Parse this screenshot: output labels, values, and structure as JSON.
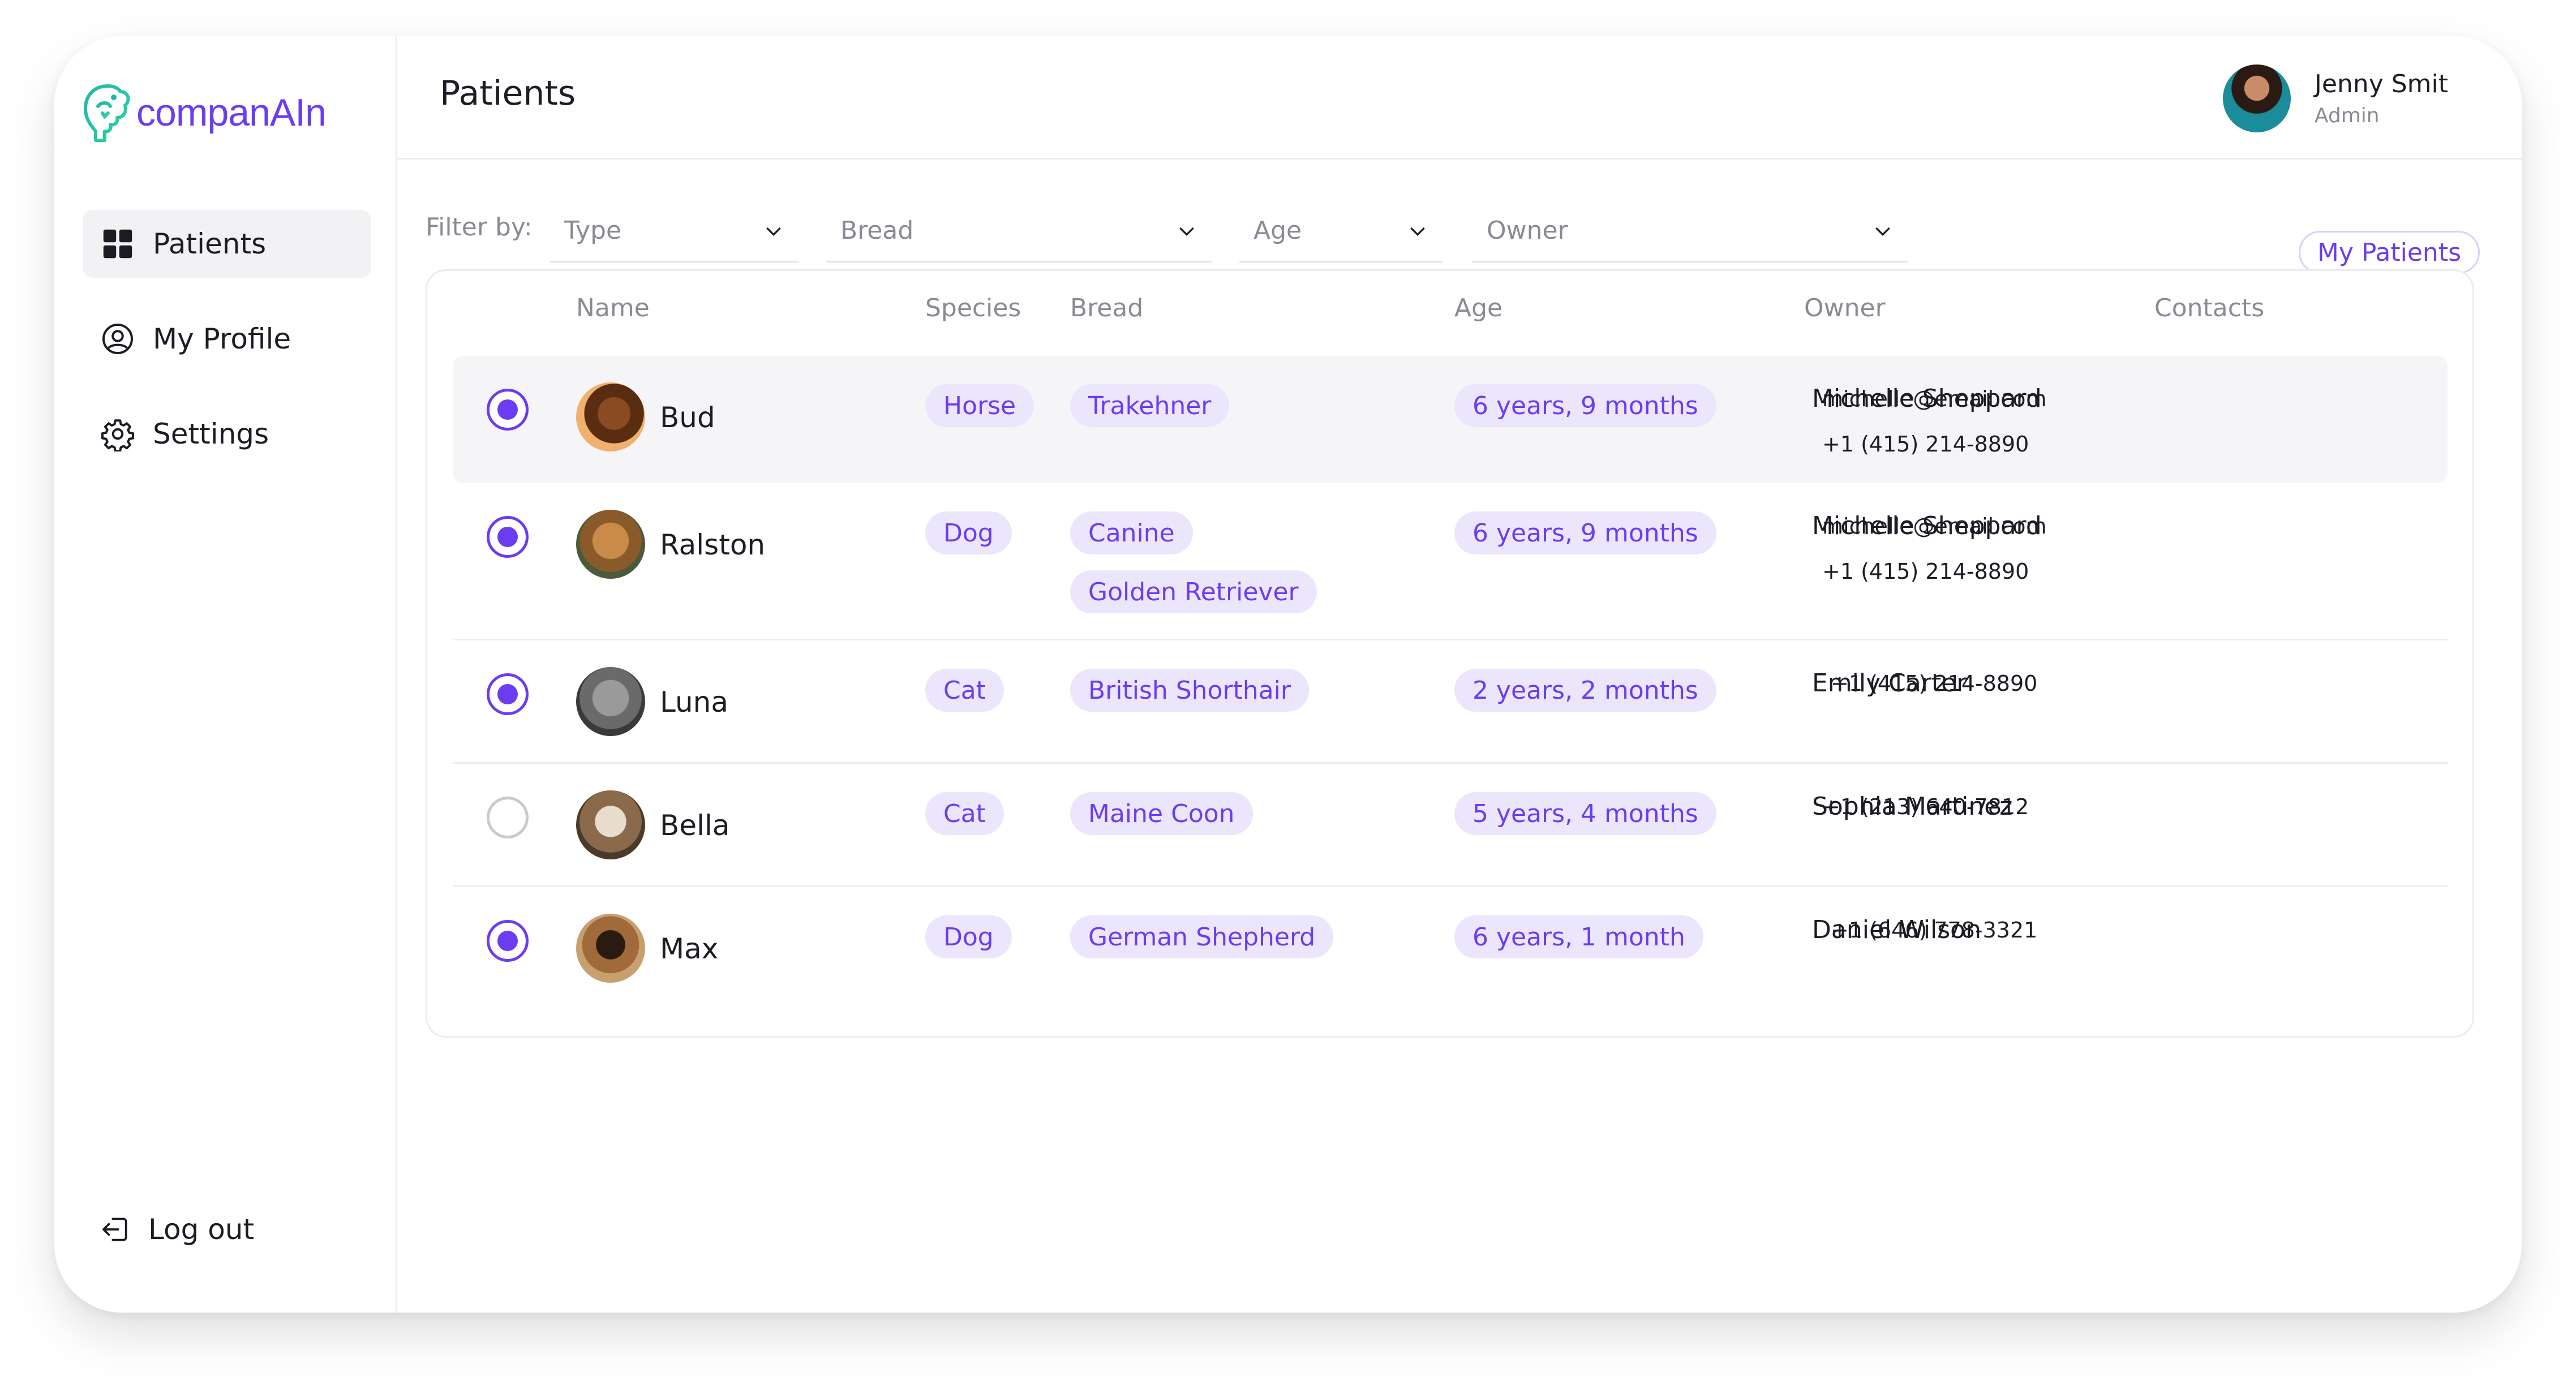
{
  "app": {
    "logo_text": "companAIn",
    "brand_color": "#6b3cf0",
    "logo_color": "#1fb8a6"
  },
  "sidebar": {
    "items": [
      {
        "label": "Patients",
        "icon": "grid-icon",
        "active": true
      },
      {
        "label": "My Profile",
        "icon": "user-circle-icon",
        "active": false
      },
      {
        "label": "Settings",
        "icon": "gear-icon",
        "active": false
      }
    ],
    "logout_label": "Log out"
  },
  "header": {
    "title": "Patients",
    "user_name": "Jenny Smit",
    "user_role": "Admin"
  },
  "filters": {
    "label": "Filter by:",
    "type": "Type",
    "bread": "Bread",
    "age": "Age",
    "owner": "Owner",
    "my_patients": "My Patients"
  },
  "table": {
    "columns": {
      "name": "Name",
      "species": "Species",
      "bread": "Bread",
      "age": "Age",
      "owner": "Owner",
      "contacts": "Contacts"
    },
    "rows": [
      {
        "name": "Bud",
        "species": "Horse",
        "breeds": [
          "Trakehner"
        ],
        "age": "6 years, 9 months",
        "owner": "Michelle Sheppard",
        "email": "michelle@email.com",
        "phone": "+1 (415) 214-8890",
        "selected": true
      },
      {
        "name": "Ralston",
        "species": "Dog",
        "breeds": [
          "Canine",
          "Golden Retriever"
        ],
        "age": "6 years, 9 months",
        "owner": "Michelle Sheppard",
        "email": "michelle@email.com",
        "phone": "+1 (415) 214-8890",
        "selected": true
      },
      {
        "name": "Luna",
        "species": "Cat",
        "breeds": [
          "British Shorthair"
        ],
        "age": "2 years, 2 months",
        "owner": "Emily Carter",
        "email": "",
        "phone": "+1 (415) 214-8890",
        "selected": true
      },
      {
        "name": "Bella",
        "species": "Cat",
        "breeds": [
          "Maine Coon"
        ],
        "age": "5 years, 4 months",
        "owner": "Sophia Martinez",
        "email": "",
        "phone": "+1 (213) 640-7812",
        "selected": false
      },
      {
        "name": "Max",
        "species": "Dog",
        "breeds": [
          "German Shepherd"
        ],
        "age": "6 years, 1 month",
        "owner": "Daniel Wilson",
        "email": "",
        "phone": "+1 (646) 778-3321",
        "selected": true
      }
    ]
  }
}
